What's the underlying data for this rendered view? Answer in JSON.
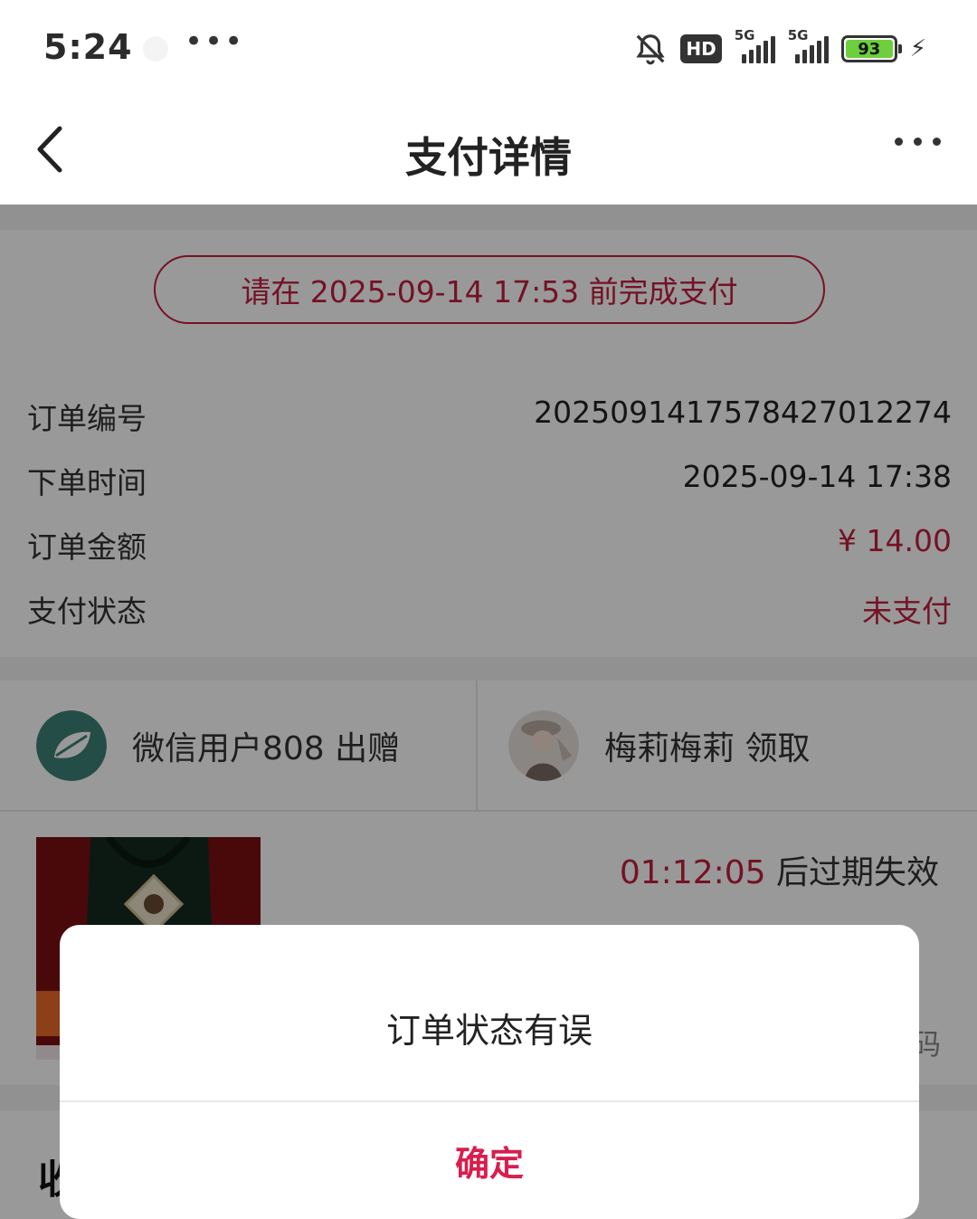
{
  "status_bar": {
    "time": "5:24",
    "more": "•••",
    "hd": "HD",
    "sim1": "5G",
    "sim2": "5G",
    "battery": "93"
  },
  "nav": {
    "title": "支付详情"
  },
  "order": {
    "deadline_text": "请在 2025-09-14 17:53 前完成支付",
    "rows": [
      {
        "label": "订单编号",
        "value": "2025091417578427012274"
      },
      {
        "label": "下单时间",
        "value": "2025-09-14 17:38"
      },
      {
        "label": "订单金额",
        "value": "¥ 14.00"
      },
      {
        "label": "支付状态",
        "value": "未支付"
      }
    ]
  },
  "users": {
    "giver": "微信用户808 出赠",
    "receiver": "梅莉梅莉 领取"
  },
  "product": {
    "countdown": "01:12:05",
    "expire_suffix": " 后过期失效",
    "code_peek": "码"
  },
  "bottom": {
    "title_peek": "收"
  },
  "dialog": {
    "message": "订单状态有误",
    "confirm": "确定"
  },
  "colors": {
    "accent": "#c21f3e",
    "confirm": "#d81e4e"
  }
}
